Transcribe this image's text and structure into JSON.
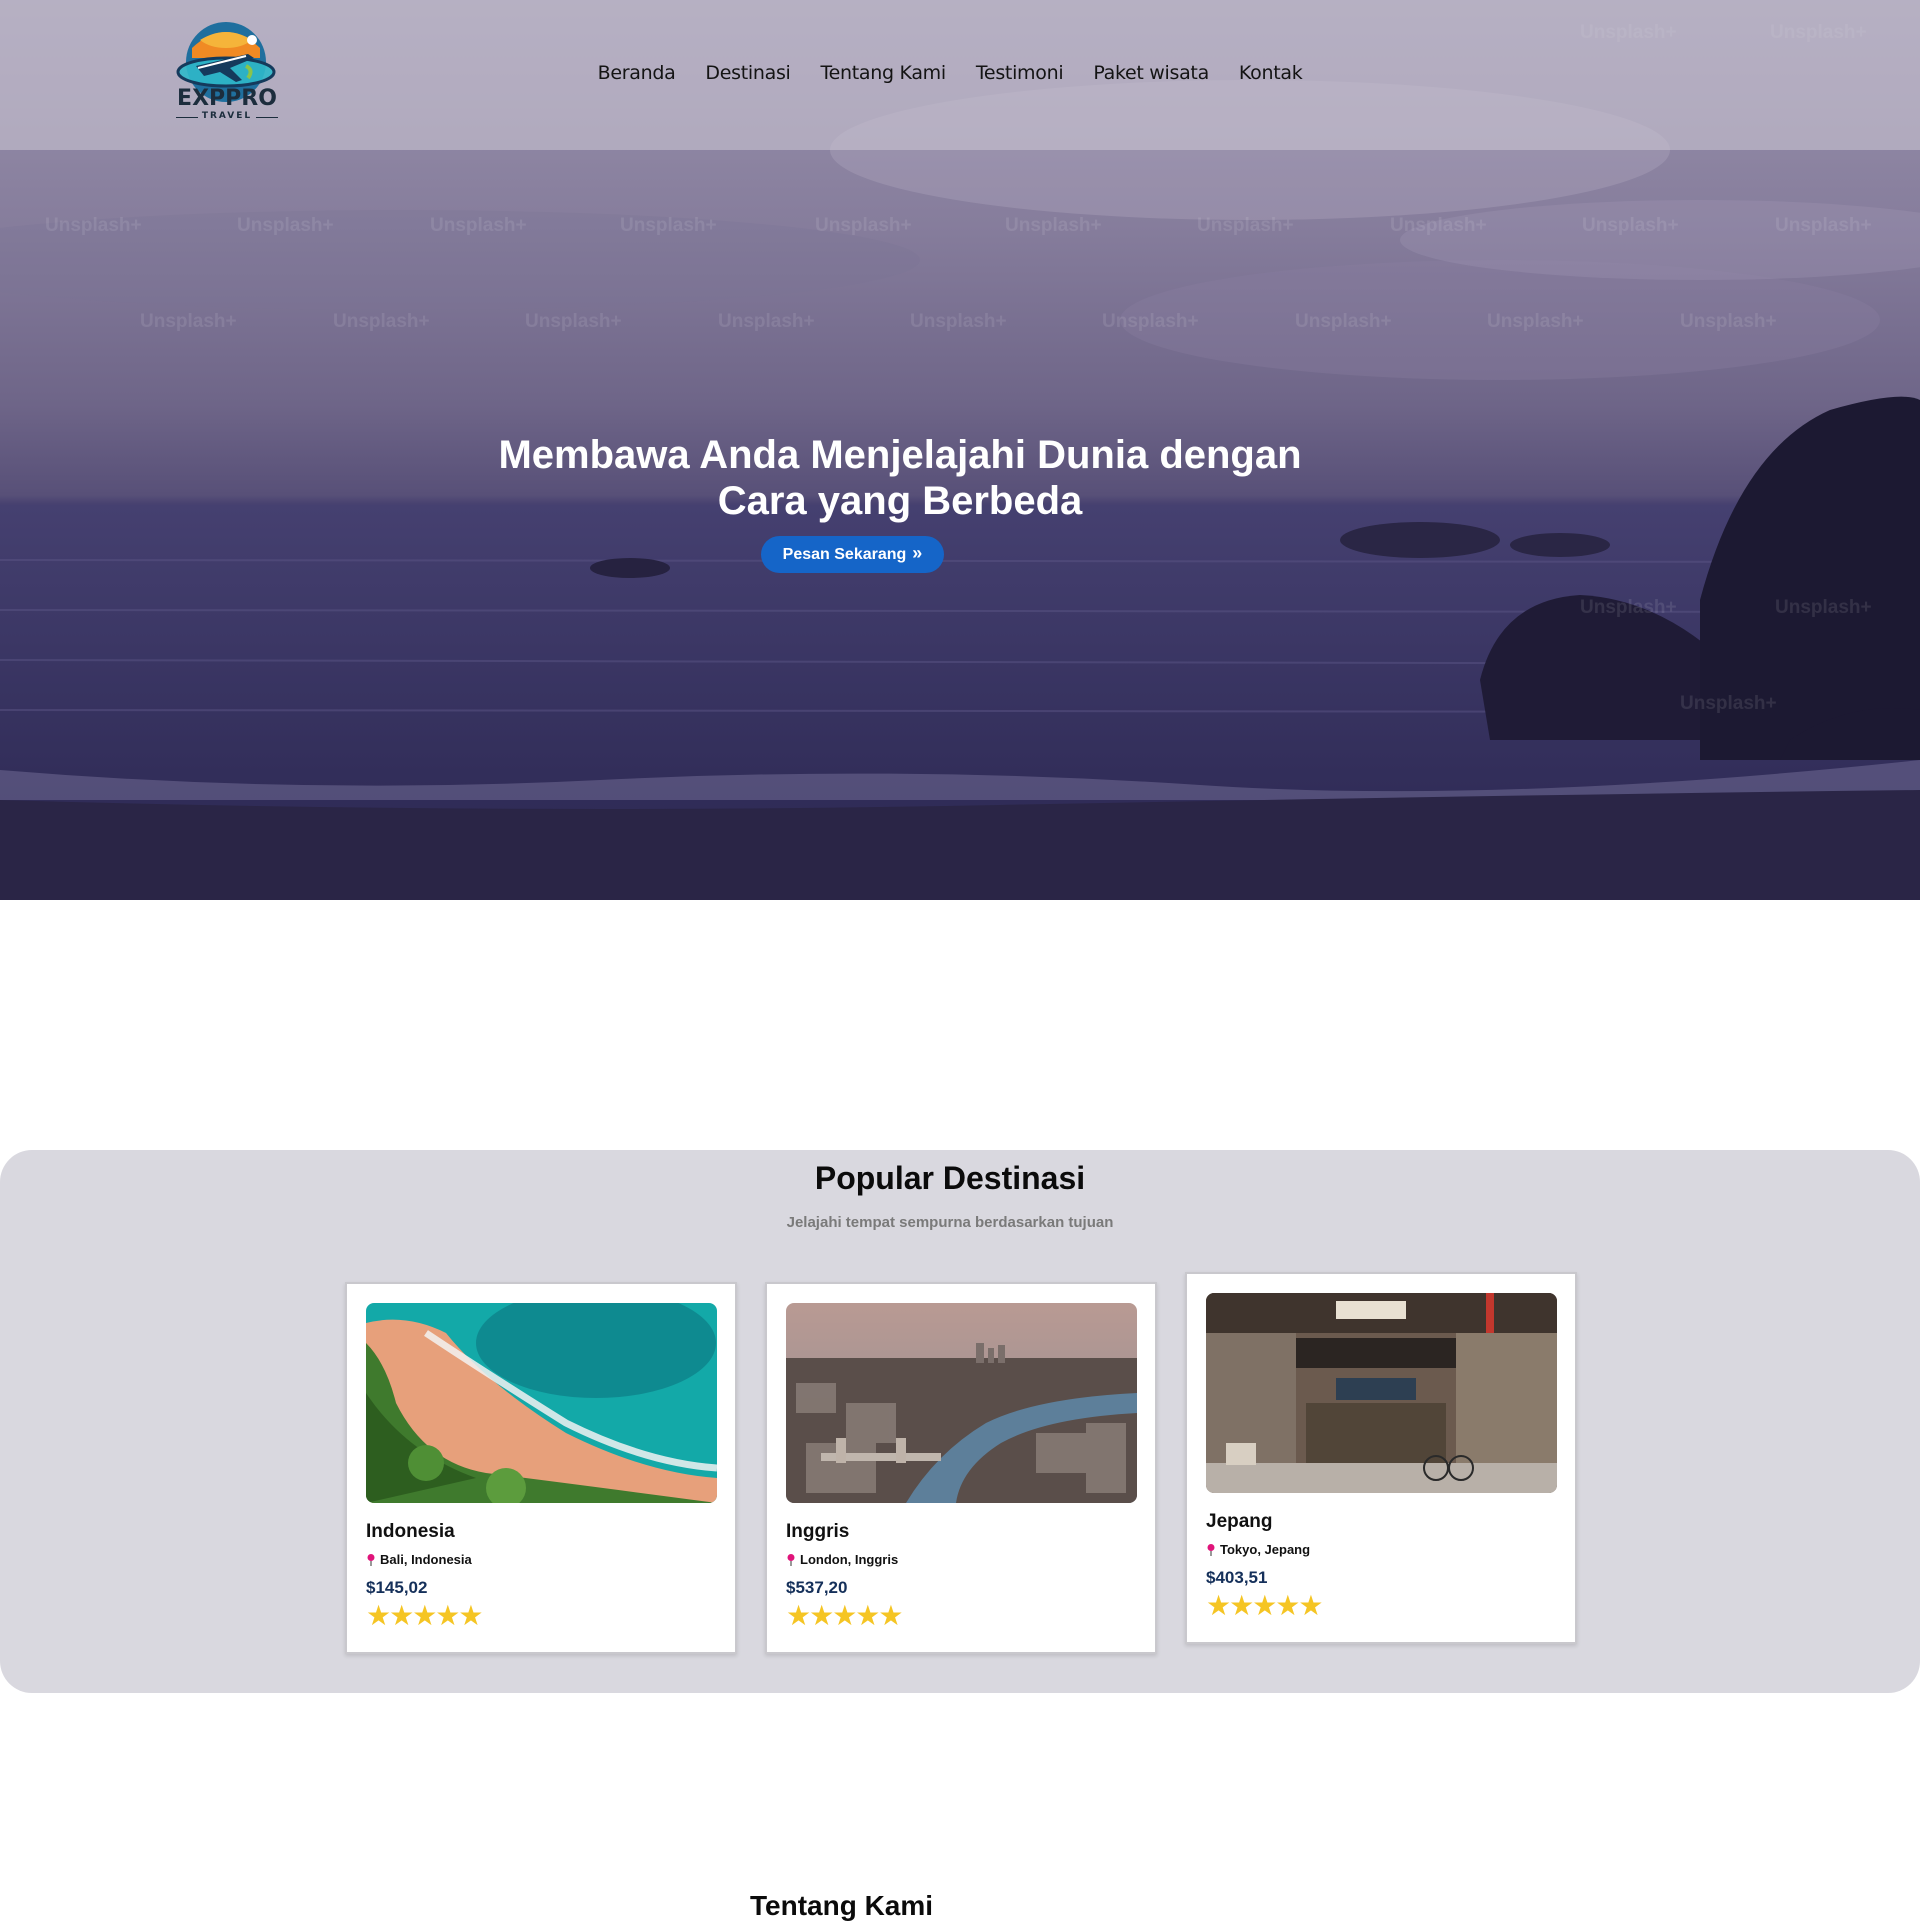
{
  "nav": {
    "brand": "EXPPRO",
    "brand_sub": "TRAVEL",
    "links": [
      "Beranda",
      "Destinasi",
      "Tentang Kami",
      "Testimoni",
      "Paket wisata",
      "Kontak"
    ]
  },
  "hero": {
    "title_line1": "Membawa Anda Menjelajahi Dunia dengan",
    "title_line2": "Cara yang Berbeda",
    "cta_label": "Pesan Sekarang",
    "cta_icon": "double-chevron-right-icon",
    "watermark": "Unsplash+"
  },
  "popular": {
    "title": "Popular Destinasi",
    "subtitle": "Jelajahi tempat sempurna berdasarkan tujuan",
    "cards": [
      {
        "name": "Indonesia",
        "location": "Bali, Indonesia",
        "price": "$145,02",
        "rating": 5,
        "stars": "★★★★★",
        "image": "beach-aerial-image"
      },
      {
        "name": "Inggris",
        "location": "London, Inggris",
        "price": "$537,20",
        "rating": 5,
        "stars": "★★★★★",
        "image": "city-river-image"
      },
      {
        "name": "Jepang",
        "location": "Tokyo, Jepang",
        "price": "$403,51",
        "rating": 5,
        "stars": "★★★★★",
        "image": "japanese-shop-image"
      }
    ]
  },
  "about": {
    "title": "Tentang Kami"
  },
  "colors": {
    "accent": "#1565c8",
    "star": "#f5c524",
    "price": "#15305a",
    "pin": "#e0147a",
    "section_bg": "#d9d8df"
  }
}
